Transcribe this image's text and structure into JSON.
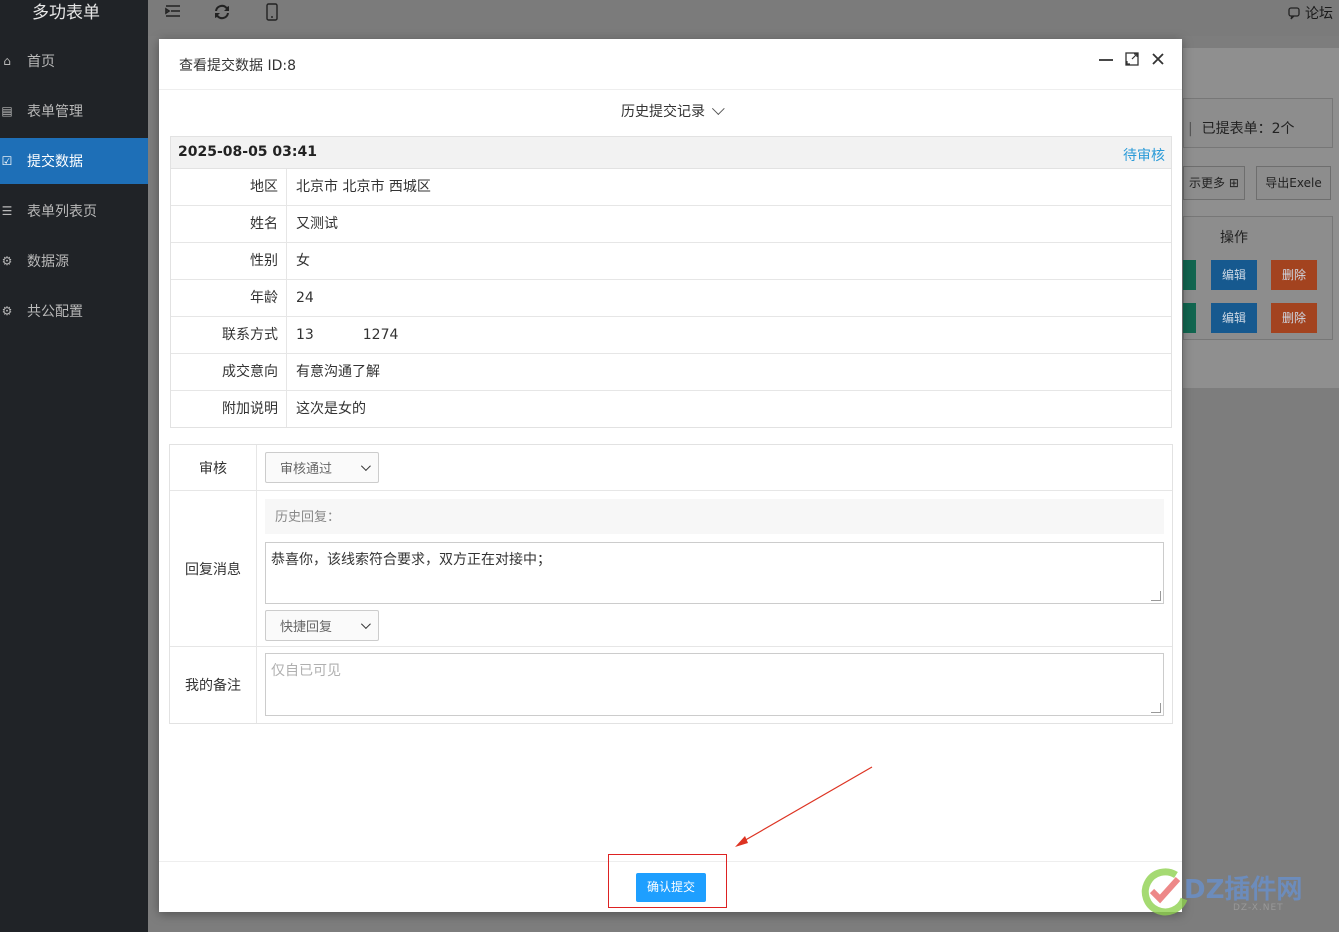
{
  "sidebar": {
    "brand": "多功表单",
    "items": [
      {
        "label": "首页",
        "icon": "home-icon",
        "glyph": "⌂",
        "active": false
      },
      {
        "label": "表单管理",
        "icon": "form-icon",
        "glyph": "▤",
        "active": false
      },
      {
        "label": "提交数据",
        "icon": "submit-data-icon",
        "glyph": "☑",
        "active": true
      },
      {
        "label": "表单列表页",
        "icon": "list-icon",
        "glyph": "☰",
        "active": false
      },
      {
        "label": "数据源",
        "icon": "datasource-icon",
        "glyph": "⚙",
        "active": false
      },
      {
        "label": "共公配置",
        "icon": "gear-icon",
        "glyph": "⚙",
        "active": false
      }
    ]
  },
  "topbar": {
    "forum_label": "论坛"
  },
  "background": {
    "submitted_count": "已提表单：2个",
    "more_btn": "示更多",
    "export_btn": "导出Exele",
    "op_header": "操作",
    "edit_label": "编辑",
    "delete_label": "删除",
    "colors": {
      "edit": "#16598f",
      "delete": "#a3431f",
      "view": "#126650"
    }
  },
  "modal": {
    "title": "查看提交数据 ID:8",
    "history_toggle": "历史提交记录",
    "record": {
      "date": "2025-08-05 03:41",
      "status": "待审核",
      "fields": [
        {
          "label": "地区",
          "value": "北京市 北京市 西城区"
        },
        {
          "label": "姓名",
          "value": "又测试"
        },
        {
          "label": "性别",
          "value": "女"
        },
        {
          "label": "年龄",
          "value": "24"
        },
        {
          "label": "联系方式",
          "value": "13           1274"
        },
        {
          "label": "成交意向",
          "value": "有意沟通了解"
        },
        {
          "label": "附加说明",
          "value": "这次是女的"
        }
      ]
    },
    "review": {
      "label": "审核",
      "selected": "审核通过"
    },
    "reply": {
      "label": "回复消息",
      "history_label": "历史回复：",
      "message": "恭喜你，该线索符合要求，双方正在对接中；",
      "quick_reply": "快捷回复"
    },
    "note": {
      "label": "我的备注",
      "placeholder": "仅自已可见"
    },
    "submit_label": "确认提交"
  },
  "watermark": {
    "text": "DZ插件网",
    "sub": "DZ-X.NET"
  }
}
